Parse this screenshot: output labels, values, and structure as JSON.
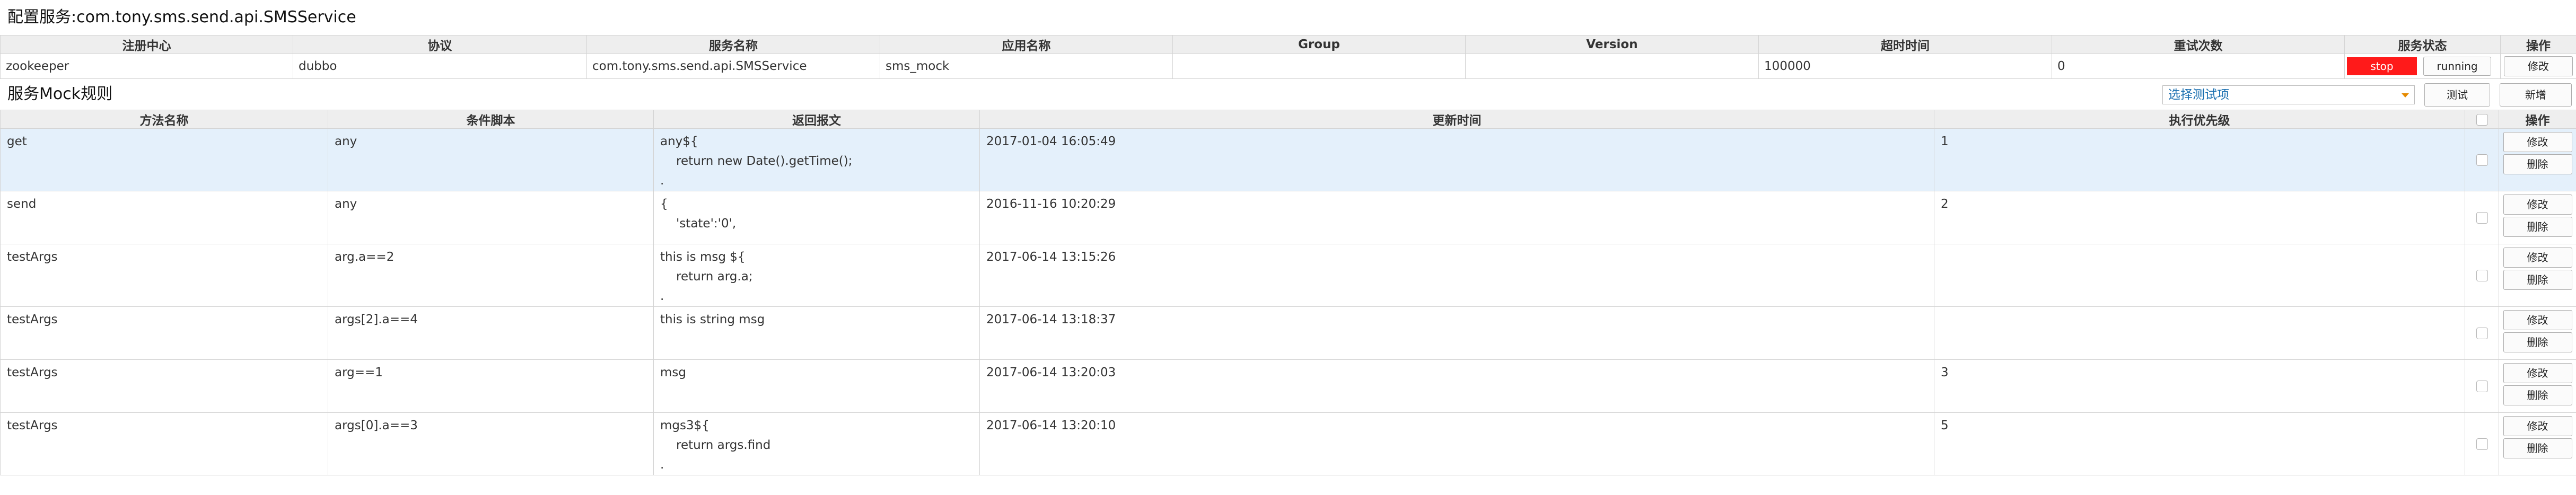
{
  "page": {
    "title": "配置服务:com.tony.sms.send.api.SMSService"
  },
  "config": {
    "headers": [
      "注册中心",
      "协议",
      "服务名称",
      "应用名称",
      "Group",
      "Version",
      "超时时间",
      "重试次数",
      "服务状态",
      "操作"
    ],
    "row": {
      "registry": "zookeeper",
      "protocol": "dubbo",
      "service_name": "com.tony.sms.send.api.SMSService",
      "app_name": "sms_mock",
      "group": "",
      "version": "",
      "timeout": "100000",
      "retries": "0",
      "stop_label": "stop",
      "running_label": "running",
      "edit_label": "修改"
    },
    "stop_color": "#ff1a1a"
  },
  "mock": {
    "title": "服务Mock规则",
    "select_placeholder": "选择测试项",
    "test_label": "测试",
    "add_label": "新增",
    "headers": [
      "方法名称",
      "条件脚本",
      "返回报文",
      "更新时间",
      "执行优先级",
      "操作"
    ],
    "edit_label": "修改",
    "delete_label": "删除",
    "highlight_color": "#e4f0fb",
    "rows": [
      {
        "method": "get",
        "condition": "any",
        "response": [
          "any${",
          "return new Date().getTime();",
          "."
        ],
        "updated": "2017-01-04 16:05:49",
        "priority": "1"
      },
      {
        "method": "send",
        "condition": "any",
        "response": [
          "{",
          "'state':'0',"
        ],
        "updated": "2016-11-16 10:20:29",
        "priority": "2"
      },
      {
        "method": "testArgs",
        "condition": "arg.a==2",
        "response": [
          "this is msg ${",
          "return arg.a;",
          "."
        ],
        "updated": "2017-06-14 13:15:26",
        "priority": ""
      },
      {
        "method": "testArgs",
        "condition": "args[2].a==4",
        "response": [
          "this is string msg"
        ],
        "updated": "2017-06-14 13:18:37",
        "priority": ""
      },
      {
        "method": "testArgs",
        "condition": "arg==1",
        "response": [
          "msg"
        ],
        "updated": "2017-06-14 13:20:03",
        "priority": "3"
      },
      {
        "method": "testArgs",
        "condition": "args[0].a==3",
        "response": [
          "mgs3${",
          "return args.find",
          "."
        ],
        "updated": "2017-06-14 13:20:10",
        "priority": "5"
      }
    ]
  }
}
